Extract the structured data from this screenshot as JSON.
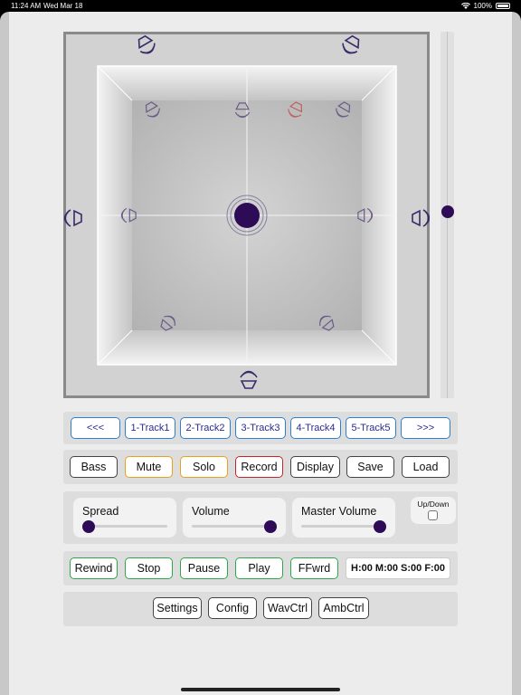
{
  "status_bar": {
    "time": "11:24 AM",
    "date": "Wed Mar 18",
    "battery": "100%"
  },
  "room": {
    "source_color": "#2e0b56",
    "speaker_color": "#3a2a6a",
    "muted_speaker_color": "#c06060"
  },
  "height_slider": {
    "value": 0.49
  },
  "nav": {
    "prev_label": "<<<",
    "next_label": ">>>",
    "tracks": [
      "1-Track1",
      "2-Track2",
      "3-Track3",
      "4-Track4",
      "5-Track5"
    ]
  },
  "controls": {
    "bass_label": "Bass",
    "mute_label": "Mute",
    "solo_label": "Solo",
    "record_label": "Record",
    "display_label": "Display",
    "save_label": "Save",
    "load_label": "Load"
  },
  "sliders": {
    "spread": {
      "label": "Spread",
      "value": 0.0
    },
    "volume": {
      "label": "Volume",
      "value": 1.0
    },
    "master_volume": {
      "label": "Master Volume",
      "value": 1.0
    }
  },
  "updown": {
    "label": "Up/Down",
    "checked": false
  },
  "transport": {
    "rewind_label": "Rewind",
    "stop_label": "Stop",
    "pause_label": "Pause",
    "play_label": "Play",
    "ffwrd_label": "FFwrd",
    "timecode": "H:00 M:00 S:00 F:00"
  },
  "footer": {
    "settings_label": "Settings",
    "config_label": "Config",
    "wavctrl_label": "WavCtrl",
    "ambctrl_label": "AmbCtrl"
  }
}
